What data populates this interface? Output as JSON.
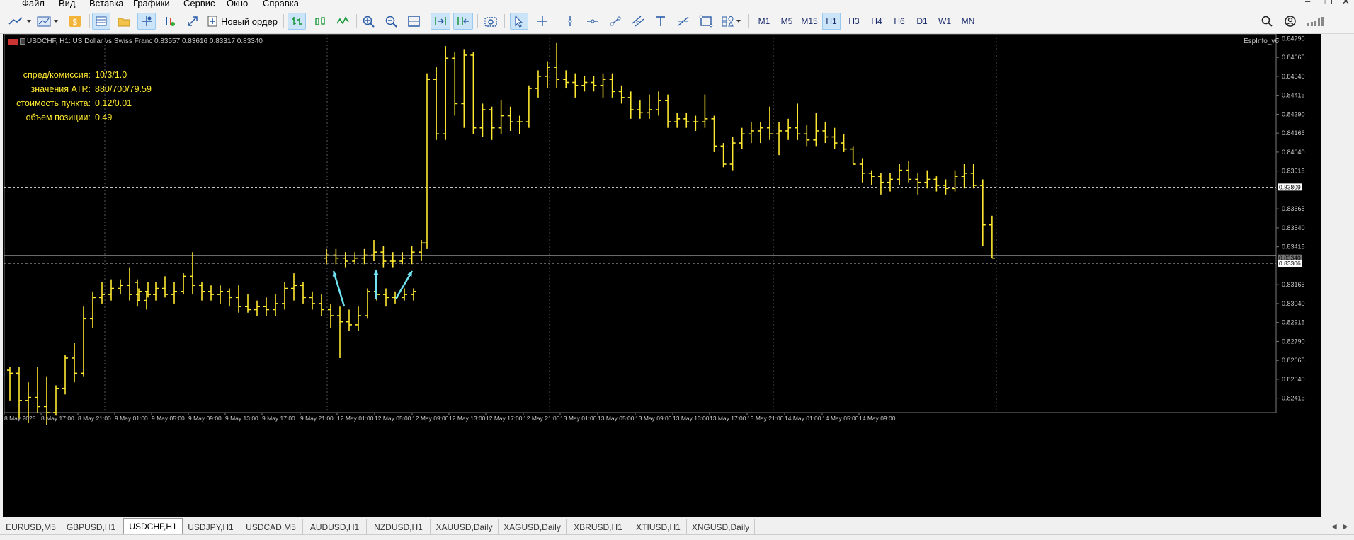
{
  "menu": [
    "Файл",
    "Вид",
    "Вставка",
    "Графики",
    "Сервис",
    "Окно",
    "Справка"
  ],
  "toolbar": {
    "new_order_label": "Новый ордер",
    "timeframes": [
      "M1",
      "M5",
      "M15",
      "H1",
      "H3",
      "H4",
      "H6",
      "D1",
      "W1",
      "MN"
    ],
    "active_timeframe": "H1"
  },
  "chart": {
    "header": "USDCHF, H1:  US Dollar vs Swiss Franc  0.83557 0.83616 0.83317 0.83340",
    "indicator_label": "EspInfo_v6",
    "info_panel": [
      {
        "label": "спред/комиссия:",
        "value": "10/3/1.0"
      },
      {
        "label": "значения ATR:",
        "value": "880/700/79.59"
      },
      {
        "label": "стоимость пункта:",
        "value": "0.12/0.01"
      },
      {
        "label": "объем позиции:",
        "value": "0.49"
      }
    ],
    "price_labels": [
      "0.84790",
      "0.84665",
      "0.84540",
      "0.84415",
      "0.84290",
      "0.84165",
      "0.84040",
      "0.83915",
      "0.83665",
      "0.83540",
      "0.83415",
      "0.83165",
      "0.83040",
      "0.82915",
      "0.82790",
      "0.82665",
      "0.82540",
      "0.82415"
    ],
    "hline_label_1": "0.83809",
    "hline_label_2": "0.83340",
    "hline_label_3": "0.83306",
    "time_labels": [
      "8 May 2025",
      "8 May 17:00",
      "8 May 21:00",
      "9 May 01:00",
      "9 May 05:00",
      "9 May 09:00",
      "9 May 13:00",
      "9 May 17:00",
      "9 May 21:00",
      "12 May 01:00",
      "12 May 05:00",
      "12 May 09:00",
      "12 May 13:00",
      "12 May 17:00",
      "12 May 21:00",
      "13 May 01:00",
      "13 May 05:00",
      "13 May 09:00",
      "13 May 13:00",
      "13 May 17:00",
      "13 May 21:00",
      "14 May 01:00",
      "14 May 05:00",
      "14 May 09:00"
    ],
    "colors": {
      "bars": "#ffe830",
      "arrows": "#6fe3f0",
      "grid": "#5a5a5a",
      "hline": "#ffffff"
    }
  },
  "chart_data": {
    "type": "ohlc",
    "title": "USDCHF, H1:  US Dollar vs Swiss Franc",
    "ylim": [
      0.8232,
      0.8482
    ],
    "bars": [
      [
        0.826,
        0.8262,
        0.824,
        0.8258
      ],
      [
        0.8258,
        0.8262,
        0.8228,
        0.824
      ],
      [
        0.824,
        0.8252,
        0.8225,
        0.8242
      ],
      [
        0.8242,
        0.8262,
        0.8232,
        0.8236
      ],
      [
        0.8236,
        0.8256,
        0.8224,
        0.8232
      ],
      [
        0.8232,
        0.825,
        0.823,
        0.8248
      ],
      [
        0.8248,
        0.827,
        0.8244,
        0.8268
      ],
      [
        0.8268,
        0.8278,
        0.8252,
        0.8258
      ],
      [
        0.8258,
        0.8302,
        0.8256,
        0.8294
      ],
      [
        0.8294,
        0.8312,
        0.8288,
        0.8308
      ],
      [
        0.8308,
        0.8318,
        0.8304,
        0.831
      ],
      [
        0.831,
        0.832,
        0.8306,
        0.8314
      ],
      [
        0.8314,
        0.832,
        0.831,
        0.8316
      ],
      [
        0.8316,
        0.8328,
        0.8306,
        0.831
      ],
      [
        0.831,
        0.8314,
        0.8306,
        0.8312
      ],
      [
        0.8312,
        0.8318,
        0.8308,
        0.831
      ],
      [
        0.8318,
        0.832,
        0.8302,
        0.8306
      ],
      [
        0.8306,
        0.8312,
        0.83,
        0.831
      ],
      [
        0.831,
        0.8318,
        0.8306,
        0.8314
      ],
      [
        0.8314,
        0.8322,
        0.8308,
        0.831
      ],
      [
        0.831,
        0.8318,
        0.8304,
        0.8312
      ],
      [
        0.8312,
        0.8324,
        0.831,
        0.8322
      ],
      [
        0.8322,
        0.8338,
        0.831,
        0.8316
      ],
      [
        0.8316,
        0.8318,
        0.8306,
        0.8312
      ],
      [
        0.8312,
        0.8316,
        0.8306,
        0.831
      ],
      [
        0.831,
        0.8316,
        0.8304,
        0.8312
      ],
      [
        0.8312,
        0.8314,
        0.8302,
        0.8308
      ],
      [
        0.8308,
        0.8316,
        0.8298,
        0.8302
      ],
      [
        0.8302,
        0.831,
        0.8298,
        0.83
      ],
      [
        0.83,
        0.8306,
        0.8296,
        0.8302
      ],
      [
        0.8302,
        0.8308,
        0.8296,
        0.83
      ],
      [
        0.83,
        0.831,
        0.8296,
        0.8304
      ],
      [
        0.8304,
        0.8318,
        0.83,
        0.8314
      ],
      [
        0.8314,
        0.8324,
        0.8306,
        0.8316
      ],
      [
        0.8316,
        0.8318,
        0.8304,
        0.8308
      ],
      [
        0.8308,
        0.8312,
        0.83,
        0.8304
      ],
      [
        0.8304,
        0.831,
        0.8296,
        0.83
      ],
      [
        0.83,
        0.8304,
        0.8288,
        0.8296
      ],
      [
        0.8296,
        0.8302,
        0.8268,
        0.8292
      ],
      [
        0.8292,
        0.83,
        0.8286,
        0.829
      ],
      [
        0.829,
        0.8302,
        0.8286,
        0.8296
      ],
      [
        0.8296,
        0.8314,
        0.8294,
        0.8312
      ],
      [
        0.8312,
        0.8314,
        0.8306,
        0.831
      ],
      [
        0.831,
        0.8314,
        0.8302,
        0.8308
      ],
      [
        0.8308,
        0.8312,
        0.8304,
        0.8308
      ],
      [
        0.8308,
        0.8314,
        0.8306,
        0.831
      ],
      [
        0.831,
        0.8314,
        0.8306,
        0.8312
      ],
      [
        0.8334,
        0.834,
        0.833,
        0.8336
      ],
      [
        0.8336,
        0.834,
        0.833,
        0.8334
      ],
      [
        0.8334,
        0.8338,
        0.8328,
        0.8332
      ],
      [
        0.8332,
        0.8338,
        0.833,
        0.8334
      ],
      [
        0.8334,
        0.834,
        0.833,
        0.8336
      ],
      [
        0.8336,
        0.8346,
        0.8332,
        0.8338
      ],
      [
        0.8338,
        0.8342,
        0.8328,
        0.8332
      ],
      [
        0.8332,
        0.8338,
        0.8328,
        0.8332
      ],
      [
        0.8332,
        0.8338,
        0.833,
        0.8334
      ],
      [
        0.8334,
        0.8342,
        0.833,
        0.8338
      ],
      [
        0.8338,
        0.8346,
        0.8332,
        0.8344
      ],
      [
        0.8344,
        0.8456,
        0.834,
        0.8452
      ],
      [
        0.8452,
        0.846,
        0.8412,
        0.8416
      ],
      [
        0.8416,
        0.8474,
        0.8412,
        0.8466
      ],
      [
        0.8466,
        0.847,
        0.8428,
        0.8436
      ],
      [
        0.8436,
        0.8472,
        0.842,
        0.8468
      ],
      [
        0.8468,
        0.847,
        0.8416,
        0.842
      ],
      [
        0.842,
        0.8436,
        0.8414,
        0.8432
      ],
      [
        0.8432,
        0.8434,
        0.8412,
        0.842
      ],
      [
        0.842,
        0.8438,
        0.8416,
        0.8428
      ],
      [
        0.8428,
        0.8434,
        0.8418,
        0.8424
      ],
      [
        0.8424,
        0.8428,
        0.8416,
        0.8424
      ],
      [
        0.8424,
        0.8448,
        0.842,
        0.8446
      ],
      [
        0.8446,
        0.8458,
        0.844,
        0.8454
      ],
      [
        0.8454,
        0.8464,
        0.8446,
        0.846
      ],
      [
        0.846,
        0.8476,
        0.8446,
        0.8452
      ],
      [
        0.8452,
        0.8458,
        0.8446,
        0.845
      ],
      [
        0.845,
        0.8456,
        0.844,
        0.8448
      ],
      [
        0.8448,
        0.8454,
        0.8444,
        0.845
      ],
      [
        0.845,
        0.8454,
        0.8444,
        0.8448
      ],
      [
        0.8448,
        0.8456,
        0.844,
        0.8452
      ],
      [
        0.8452,
        0.8456,
        0.844,
        0.8444
      ],
      [
        0.8444,
        0.8448,
        0.8436,
        0.844
      ],
      [
        0.844,
        0.8444,
        0.8426,
        0.8432
      ],
      [
        0.8432,
        0.8438,
        0.8426,
        0.843
      ],
      [
        0.843,
        0.8442,
        0.8426,
        0.8432
      ],
      [
        0.8432,
        0.8444,
        0.8428,
        0.8438
      ],
      [
        0.8438,
        0.8442,
        0.842,
        0.8424
      ],
      [
        0.8424,
        0.843,
        0.842,
        0.8426
      ],
      [
        0.8426,
        0.843,
        0.842,
        0.8424
      ],
      [
        0.8424,
        0.8428,
        0.8418,
        0.8424
      ],
      [
        0.8424,
        0.8442,
        0.842,
        0.8426
      ],
      [
        0.8426,
        0.8428,
        0.8404,
        0.8408
      ],
      [
        0.8408,
        0.841,
        0.8394,
        0.8396
      ],
      [
        0.8396,
        0.8414,
        0.8392,
        0.841
      ],
      [
        0.841,
        0.842,
        0.8406,
        0.8416
      ],
      [
        0.8416,
        0.8424,
        0.841,
        0.8418
      ],
      [
        0.8418,
        0.8424,
        0.841,
        0.842
      ],
      [
        0.842,
        0.8434,
        0.8412,
        0.8416
      ],
      [
        0.8416,
        0.8424,
        0.8402,
        0.8418
      ],
      [
        0.8418,
        0.8426,
        0.8412,
        0.842
      ],
      [
        0.842,
        0.8436,
        0.8412,
        0.8416
      ],
      [
        0.8416,
        0.8422,
        0.8408,
        0.8412
      ],
      [
        0.8412,
        0.843,
        0.8408,
        0.8418
      ],
      [
        0.8418,
        0.8424,
        0.841,
        0.8414
      ],
      [
        0.8414,
        0.842,
        0.8406,
        0.841
      ],
      [
        0.841,
        0.8416,
        0.8404,
        0.8406
      ],
      [
        0.8406,
        0.8408,
        0.8396,
        0.8396
      ],
      [
        0.8396,
        0.84,
        0.8384,
        0.839
      ],
      [
        0.839,
        0.8392,
        0.8382,
        0.8388
      ],
      [
        0.8388,
        0.839,
        0.8376,
        0.8384
      ],
      [
        0.8384,
        0.839,
        0.8378,
        0.8386
      ],
      [
        0.8386,
        0.8396,
        0.8382,
        0.8392
      ],
      [
        0.8392,
        0.8398,
        0.8384,
        0.8386
      ],
      [
        0.8386,
        0.839,
        0.8376,
        0.8384
      ],
      [
        0.8384,
        0.8392,
        0.838,
        0.8386
      ],
      [
        0.8386,
        0.8388,
        0.8378,
        0.8382
      ],
      [
        0.8382,
        0.8386,
        0.8376,
        0.838
      ],
      [
        0.838,
        0.8392,
        0.8378,
        0.8388
      ],
      [
        0.8388,
        0.8396,
        0.838,
        0.839
      ],
      [
        0.839,
        0.8396,
        0.838,
        0.8382
      ],
      [
        0.8382,
        0.8386,
        0.8342,
        0.8356
      ],
      [
        0.8356,
        0.8362,
        0.8334,
        0.8334
      ]
    ]
  },
  "bottom_tabs": [
    "EURUSD,M5",
    "GBPUSD,H1",
    "USDCHF,H1",
    "USDJPY,H1",
    "USDCAD,M5",
    "AUDUSD,H1",
    "NZDUSD,H1",
    "XAUUSD,Daily",
    "XAGUSD,Daily",
    "XBRUSD,H1",
    "XTIUSD,H1",
    "XNGUSD,Daily"
  ],
  "active_tab": "USDCHF,H1"
}
